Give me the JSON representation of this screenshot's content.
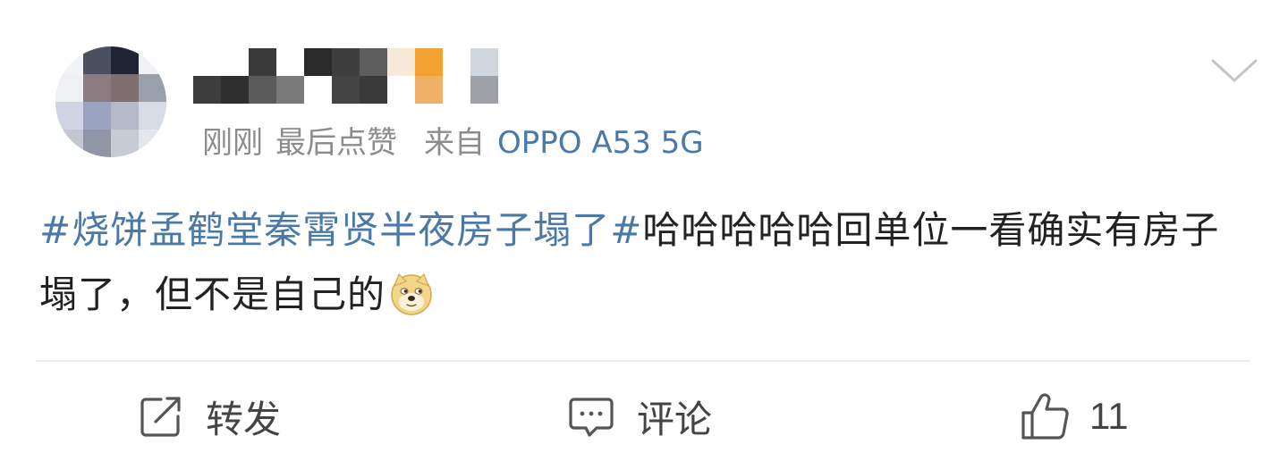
{
  "post": {
    "author": {
      "name": "",
      "avatar_icon": "user-avatar-pixelated"
    },
    "meta": {
      "time": "刚刚",
      "action": "最后点赞",
      "from_label": "来自",
      "device": "OPPO A53 5G"
    },
    "more_icon": "chevron-down-icon",
    "content": {
      "topic": "#烧饼孟鹤堂秦霄贤半夜房子塌了#",
      "text": "哈哈哈哈哈回单位一看确实有房子塌了，但不是自己的",
      "emoji": "doge-emoji"
    },
    "actions": {
      "repost_label": "转发",
      "comment_label": "评论",
      "like_count": "11"
    }
  },
  "colors": {
    "link": "#4a79a8",
    "meta_gray": "#8c8c8c",
    "text": "#222222",
    "divider": "#eeeeee"
  }
}
